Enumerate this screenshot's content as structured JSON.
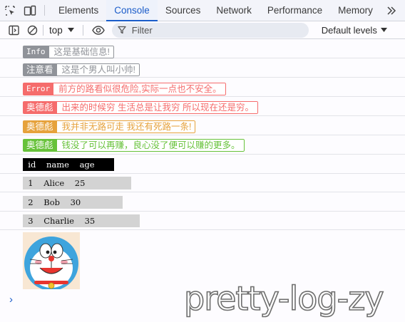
{
  "tabs": [
    {
      "label": "Elements",
      "active": false
    },
    {
      "label": "Console",
      "active": true
    },
    {
      "label": "Sources",
      "active": false
    },
    {
      "label": "Network",
      "active": false
    },
    {
      "label": "Performance",
      "active": false
    },
    {
      "label": "Memory",
      "active": false
    }
  ],
  "toolbar": {
    "context": "top",
    "filter_placeholder": "Filter",
    "levels": "Default levels"
  },
  "logs": [
    {
      "tag": "Info",
      "message": "这是基础信息!",
      "color": "#909399"
    },
    {
      "tag": "注意看",
      "message": "这是个男人叫小帅!",
      "color": "#909399"
    },
    {
      "tag": "Error",
      "message": "前方的路看似很危险,实际一点也不安全。",
      "color": "#f56c6c"
    },
    {
      "tag": "奥德彪",
      "message": "出来的时候穷 生活总是让我穷 所以现在还是穷。",
      "color": "#f56c6c"
    },
    {
      "tag": "奥德彪",
      "message": "我并非无路可走 我还有死路一条!",
      "color": "#e6a23c"
    },
    {
      "tag": "奥德彪",
      "message": "钱没了可以再赚，良心没了便可以赚的更多。",
      "color": "#67c23a"
    }
  ],
  "table": {
    "header": "  id    name    age  ",
    "rows": [
      "  1    Alice    25   ",
      "  2    Bob    30   ",
      "  3    Charlie    35   "
    ]
  },
  "avatar": {
    "icon": "doraemon-image"
  },
  "watermark": "pretty-log-zy",
  "prompt": "›"
}
